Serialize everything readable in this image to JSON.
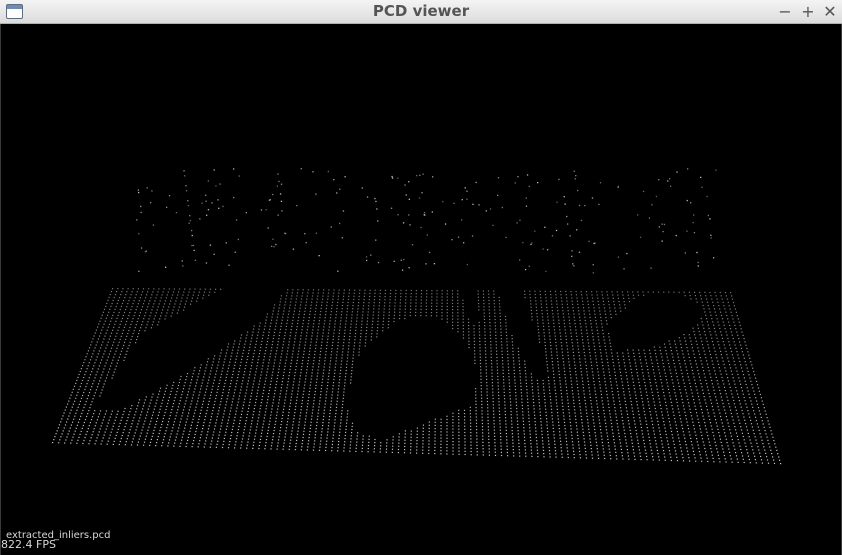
{
  "window": {
    "title": "PCD viewer",
    "controls": {
      "minimize": "−",
      "maximize": "+",
      "close": "✕"
    }
  },
  "viewer": {
    "cloud_name": "extracted_inliers.pcd",
    "fps_text": "822.4 FPS",
    "background_color": "#000000",
    "point_color": "#cfcfcf"
  }
}
